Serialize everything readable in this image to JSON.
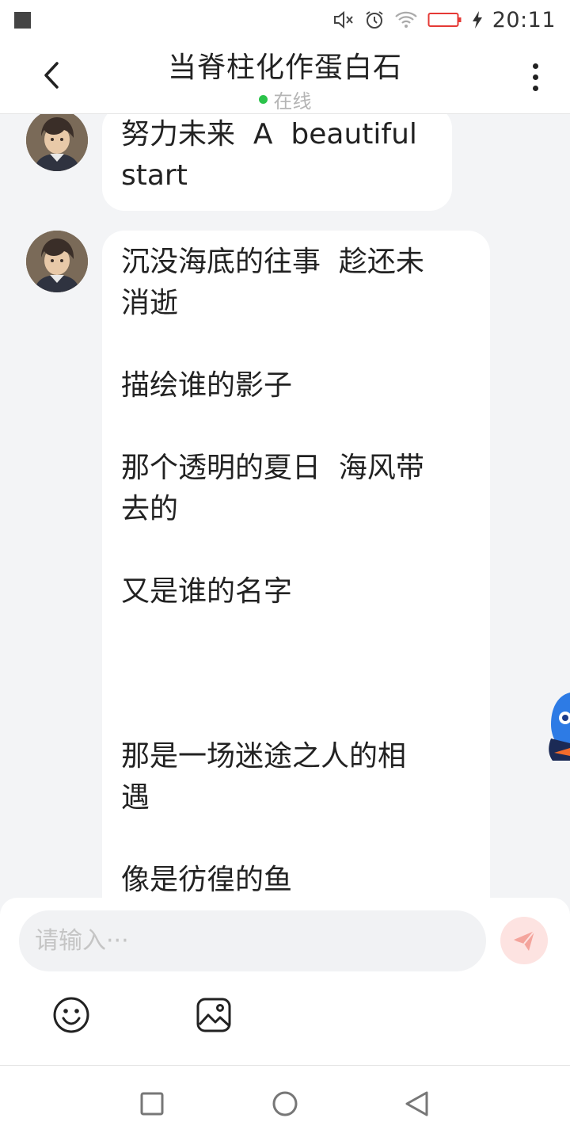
{
  "status_bar": {
    "time": "20:11",
    "icons": [
      "notification-square-icon",
      "mute-icon",
      "alarm-icon",
      "wifi-icon",
      "battery-low-icon",
      "charging-icon"
    ],
    "battery_color": "#e53935"
  },
  "header": {
    "title": "当脊柱化作蛋白石",
    "status": "在线",
    "online_color": "#2bc34a",
    "back_icon": "chevron-left-icon",
    "more_icon": "more-vertical-icon"
  },
  "messages": [
    {
      "sender_avatar": "avatar",
      "lines": [
        "努力未来  A  beautiful",
        "start"
      ]
    },
    {
      "sender_avatar": "avatar",
      "lines": [
        "沉没海底的往事  趁还未",
        "消逝",
        "",
        "描绘谁的影子",
        "",
        "那个透明的夏日  海风带",
        "去的",
        "",
        "又是谁的名字",
        "",
        "",
        "",
        "那是一场迷途之人的相",
        "遇",
        "",
        "像是彷徨的鱼"
      ]
    }
  ],
  "input": {
    "placeholder": "请输入···",
    "value": "",
    "send_icon": "send-icon",
    "accent": "#f26b5b"
  },
  "toolbar": {
    "emoji_icon": "emoji-icon",
    "image_icon": "image-icon"
  },
  "nav_bar": {
    "icons": [
      "recent-apps-icon",
      "home-icon",
      "back-triangle-icon"
    ]
  }
}
